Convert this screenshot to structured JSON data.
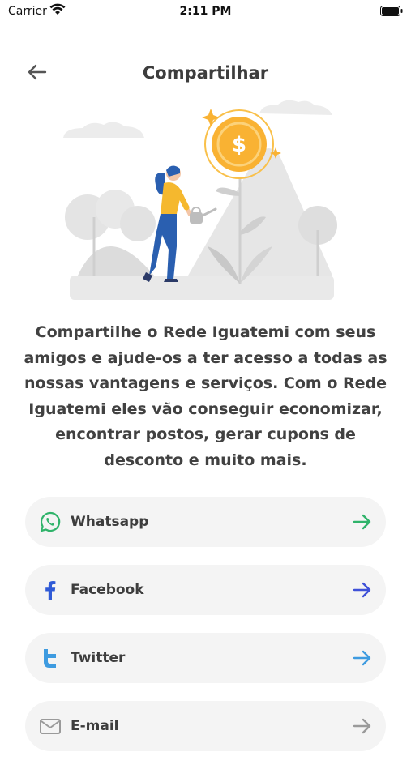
{
  "status_bar": {
    "carrier": "Carrier",
    "time": "2:11 PM"
  },
  "header": {
    "title": "Compartilhar",
    "back_icon": "arrow-left-icon"
  },
  "illustration": {
    "icon": "woman-watering-coin-plant",
    "symbol": "$"
  },
  "description": "Compartilhe o Rede Iguatemi com seus amigos e ajude-os a ter acesso a todas as nossas vantagens e serviços. Com o Rede Iguatemi eles vão conseguir economizar, encontrar postos, gerar cupons de desconto e muito mais.",
  "share_options": [
    {
      "label": "Whatsapp",
      "icon": "whatsapp-icon",
      "arrow_color": "#2fb36a"
    },
    {
      "label": "Facebook",
      "icon": "facebook-icon",
      "arrow_color": "#3f51d8"
    },
    {
      "label": "Twitter",
      "icon": "twitter-icon",
      "arrow_color": "#3e9be0"
    },
    {
      "label": "E-mail",
      "icon": "email-icon",
      "arrow_color": "#9a9a9a"
    }
  ],
  "colors": {
    "whatsapp": "#2fb36a",
    "facebook": "#2f5ad6",
    "twitter": "#3e9be0",
    "coin": "#f9b233",
    "figure_shirt": "#f5b82e",
    "figure_pants": "#2a5fb0"
  }
}
